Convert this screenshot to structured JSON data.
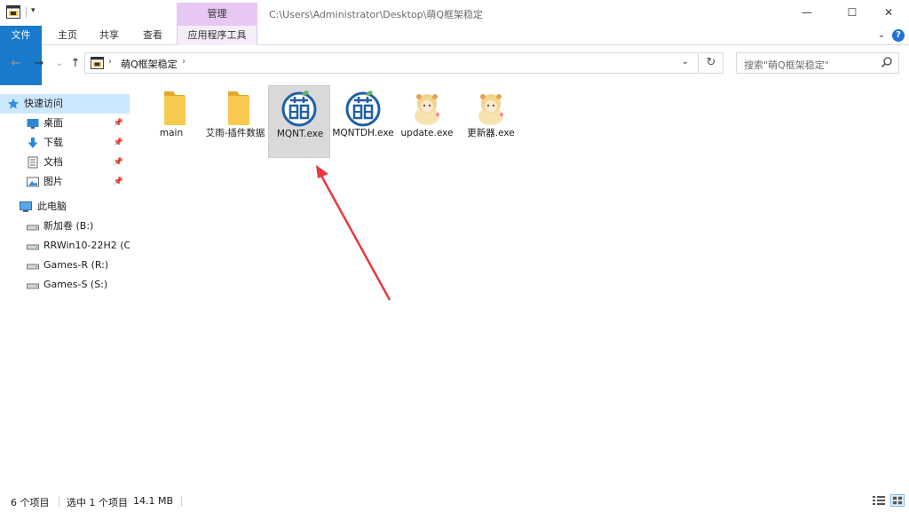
{
  "title_bar": {
    "context_tab_group": "管理",
    "path": "C:\\Users\\Administrator\\Desktop\\萌Q框架稳定",
    "minimize": "—",
    "maximize": "☐",
    "close": "✕"
  },
  "ribbon": {
    "tabs": [
      "文件",
      "主页",
      "共享",
      "查看",
      "应用程序工具"
    ],
    "collapse_glyph": "⌄",
    "help_glyph": "?"
  },
  "nav": {
    "back": "←",
    "forward": "→",
    "recent": "⌄",
    "up": "↑",
    "breadcrumb_separator": "›",
    "breadcrumb": "萌Q框架稳定",
    "dropdown": "⌄",
    "refresh": "↻",
    "search_placeholder": "搜索\"萌Q框架稳定\""
  },
  "sidebar": {
    "quick_access": "快速访问",
    "quick_items": [
      {
        "label": "桌面",
        "icon": "desktop-icon"
      },
      {
        "label": "下载",
        "icon": "download-icon"
      },
      {
        "label": "文档",
        "icon": "document-icon"
      },
      {
        "label": "图片",
        "icon": "pictures-icon"
      }
    ],
    "pin_glyph": "📌",
    "this_pc": "此电脑",
    "drives": [
      {
        "label": "新加卷 (B:)"
      },
      {
        "label": "RRWin10-22H2 (C"
      },
      {
        "label": "Games-R (R:)"
      },
      {
        "label": "Games-S (S:)"
      }
    ]
  },
  "files": [
    {
      "name": "main",
      "type": "folder"
    },
    {
      "name": "艾雨-插件数据",
      "type": "folder"
    },
    {
      "name": "MQNT.exe",
      "type": "mqnt",
      "selected": true
    },
    {
      "name": "MQNTDH.exe",
      "type": "mqnt"
    },
    {
      "name": "update.exe",
      "type": "anime"
    },
    {
      "name": "更新器.exe",
      "type": "anime"
    }
  ],
  "status_bar": {
    "item_count": "6 个项目",
    "selection": "选中 1 个项目",
    "size": "14.1 MB"
  },
  "colors": {
    "accent": "#1979ca",
    "context_tab": "#e6c8f2",
    "selection": "#cce8ff",
    "arrow": "#e8383d",
    "folder": "#f7c94f"
  }
}
